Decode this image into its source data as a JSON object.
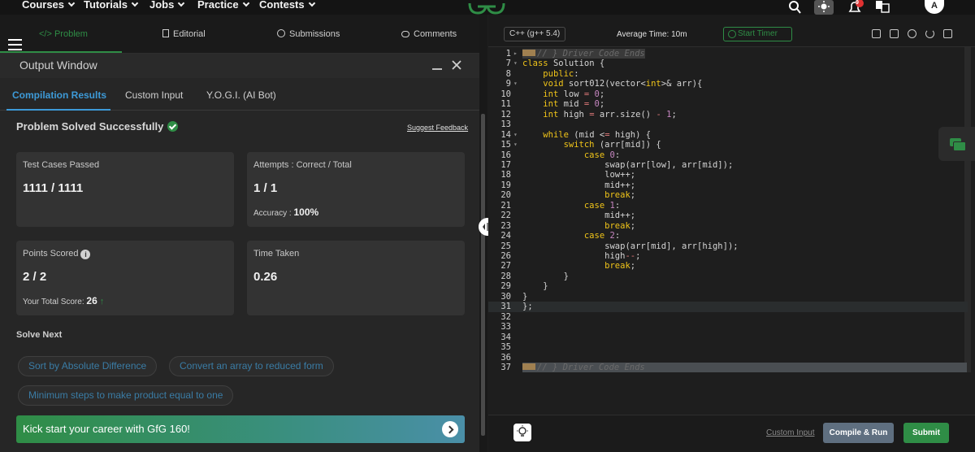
{
  "topnav": {
    "items": [
      "Courses",
      "Tutorials",
      "Jobs",
      "Practice",
      "Contests"
    ],
    "avatar": "A",
    "notification_count": "9",
    "icons": [
      "search-icon",
      "theme-toggle-icon",
      "bell-icon",
      "translate-icon"
    ]
  },
  "problem_tabs": [
    "</> Problem",
    "Editorial",
    "Submissions",
    "Comments"
  ],
  "output": {
    "title": "Output Window",
    "subtabs": [
      "Compilation Results",
      "Custom Input",
      "Y.O.G.I. (AI Bot)"
    ],
    "status": "Problem Solved Successfully",
    "feedback": "Suggest Feedback",
    "cards": {
      "test_cases_label": "Test Cases Passed",
      "test_cases_value": "1111 / 1111",
      "attempts_label": "Attempts : Correct / Total",
      "attempts_value": "1 / 1",
      "accuracy_label": "Accuracy :",
      "accuracy_value": "100%",
      "points_label": "Points Scored",
      "points_value": "2 / 2",
      "total_score_label": "Your Total Score:",
      "total_score_value": "26",
      "time_label": "Time Taken",
      "time_value": "0.26"
    },
    "solve_next_label": "Solve Next",
    "solve_next": [
      "Sort by Absolute Difference",
      "Convert an array to reduced form",
      "Minimum steps to make product equal to one"
    ],
    "banner": "Kick start your career with GfG 160!"
  },
  "editor": {
    "language": "C++ (g++ 5.4)",
    "average_time": "Average Time: 10m",
    "timer": "Start Timer",
    "custom_input": "Custom Input",
    "compile": "Compile & Run",
    "submit": "Submit",
    "line_numbers": [
      "1",
      "7",
      "8",
      "9",
      "10",
      "11",
      "12",
      "13",
      "14",
      "15",
      "16",
      "17",
      "18",
      "19",
      "20",
      "21",
      "22",
      "23",
      "24",
      "25",
      "26",
      "27",
      "28",
      "29",
      "30",
      "31",
      "32",
      "33",
      "34",
      "35",
      "36",
      "37"
    ],
    "lines": [
      "// } Driver Code Ends",
      "class Solution {",
      "    public:",
      "    void sort012(vector<int>& arr){",
      "    int low = 0;",
      "    int mid = 0;",
      "    int high = arr.size() - 1;",
      "",
      "    while (mid <= high) {",
      "        switch (arr[mid]) {",
      "            case 0:",
      "                swap(arr[low], arr[mid]);",
      "                low++;",
      "                mid++;",
      "                break;",
      "            case 1:",
      "                mid++;",
      "                break;",
      "            case 2:",
      "                swap(arr[mid], arr[high]);",
      "                high--;",
      "                break;",
      "        }",
      "    }",
      "}",
      "};",
      "",
      "",
      "",
      "",
      "",
      "// } Driver Code Ends"
    ]
  }
}
